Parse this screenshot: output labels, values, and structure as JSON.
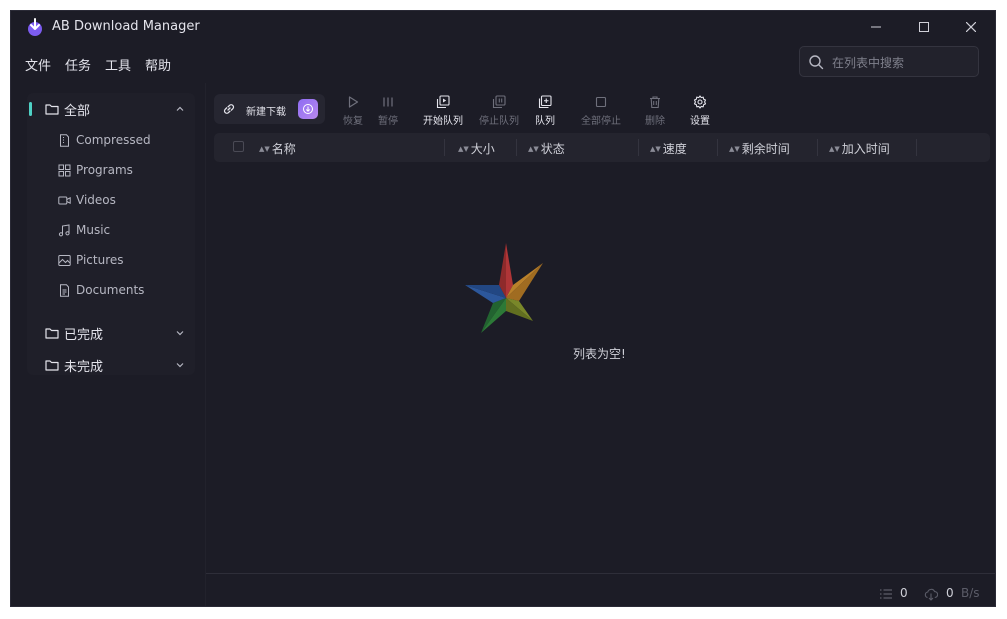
{
  "window": {
    "title": "AB Download Manager"
  },
  "menu": [
    "文件",
    "任务",
    "工具",
    "帮助"
  ],
  "search": {
    "placeholder": "在列表中搜索",
    "value": ""
  },
  "sidebar": {
    "all": {
      "label": "全部",
      "icon": "folder-icon"
    },
    "subcategories": [
      {
        "label": "Compressed",
        "icon": "archive-file-icon"
      },
      {
        "label": "Programs",
        "icon": "grid-apps-icon"
      },
      {
        "label": "Videos",
        "icon": "video-camera-icon"
      },
      {
        "label": "Music",
        "icon": "music-note-icon"
      },
      {
        "label": "Pictures",
        "icon": "image-icon"
      },
      {
        "label": "Documents",
        "icon": "document-icon"
      }
    ],
    "finished": {
      "label": "已完成",
      "icon": "folder-icon"
    },
    "unfinished": {
      "label": "未完成",
      "icon": "folder-icon"
    }
  },
  "toolbar": {
    "new_download": "新建下载",
    "buttons": [
      {
        "label": "恢复",
        "icon": "play-icon",
        "enabled": false
      },
      {
        "label": "暂停",
        "icon": "pause-icon",
        "enabled": false
      },
      {
        "label": "开始队列",
        "icon": "start-queue-icon",
        "enabled": true
      },
      {
        "label": "停止队列",
        "icon": "stop-queue-icon",
        "enabled": false
      },
      {
        "label": "队列",
        "icon": "queue-add-icon",
        "enabled": true
      },
      {
        "label": "全部停止",
        "icon": "stop-square-icon",
        "enabled": false
      },
      {
        "label": "删除",
        "icon": "trash-icon",
        "enabled": false
      },
      {
        "label": "设置",
        "icon": "gear-icon",
        "enabled": true
      }
    ]
  },
  "table": {
    "columns": [
      "名称",
      "大小",
      "状态",
      "速度",
      "剩余时间",
      "加入时间"
    ],
    "empty_message": "列表为空!"
  },
  "status": {
    "active_count": "0",
    "speed_value": "0",
    "speed_unit": "B/s"
  },
  "colors": {
    "background": "#1c1c26",
    "accent": "#4fd1c5",
    "badge": "#8e6cf3"
  }
}
